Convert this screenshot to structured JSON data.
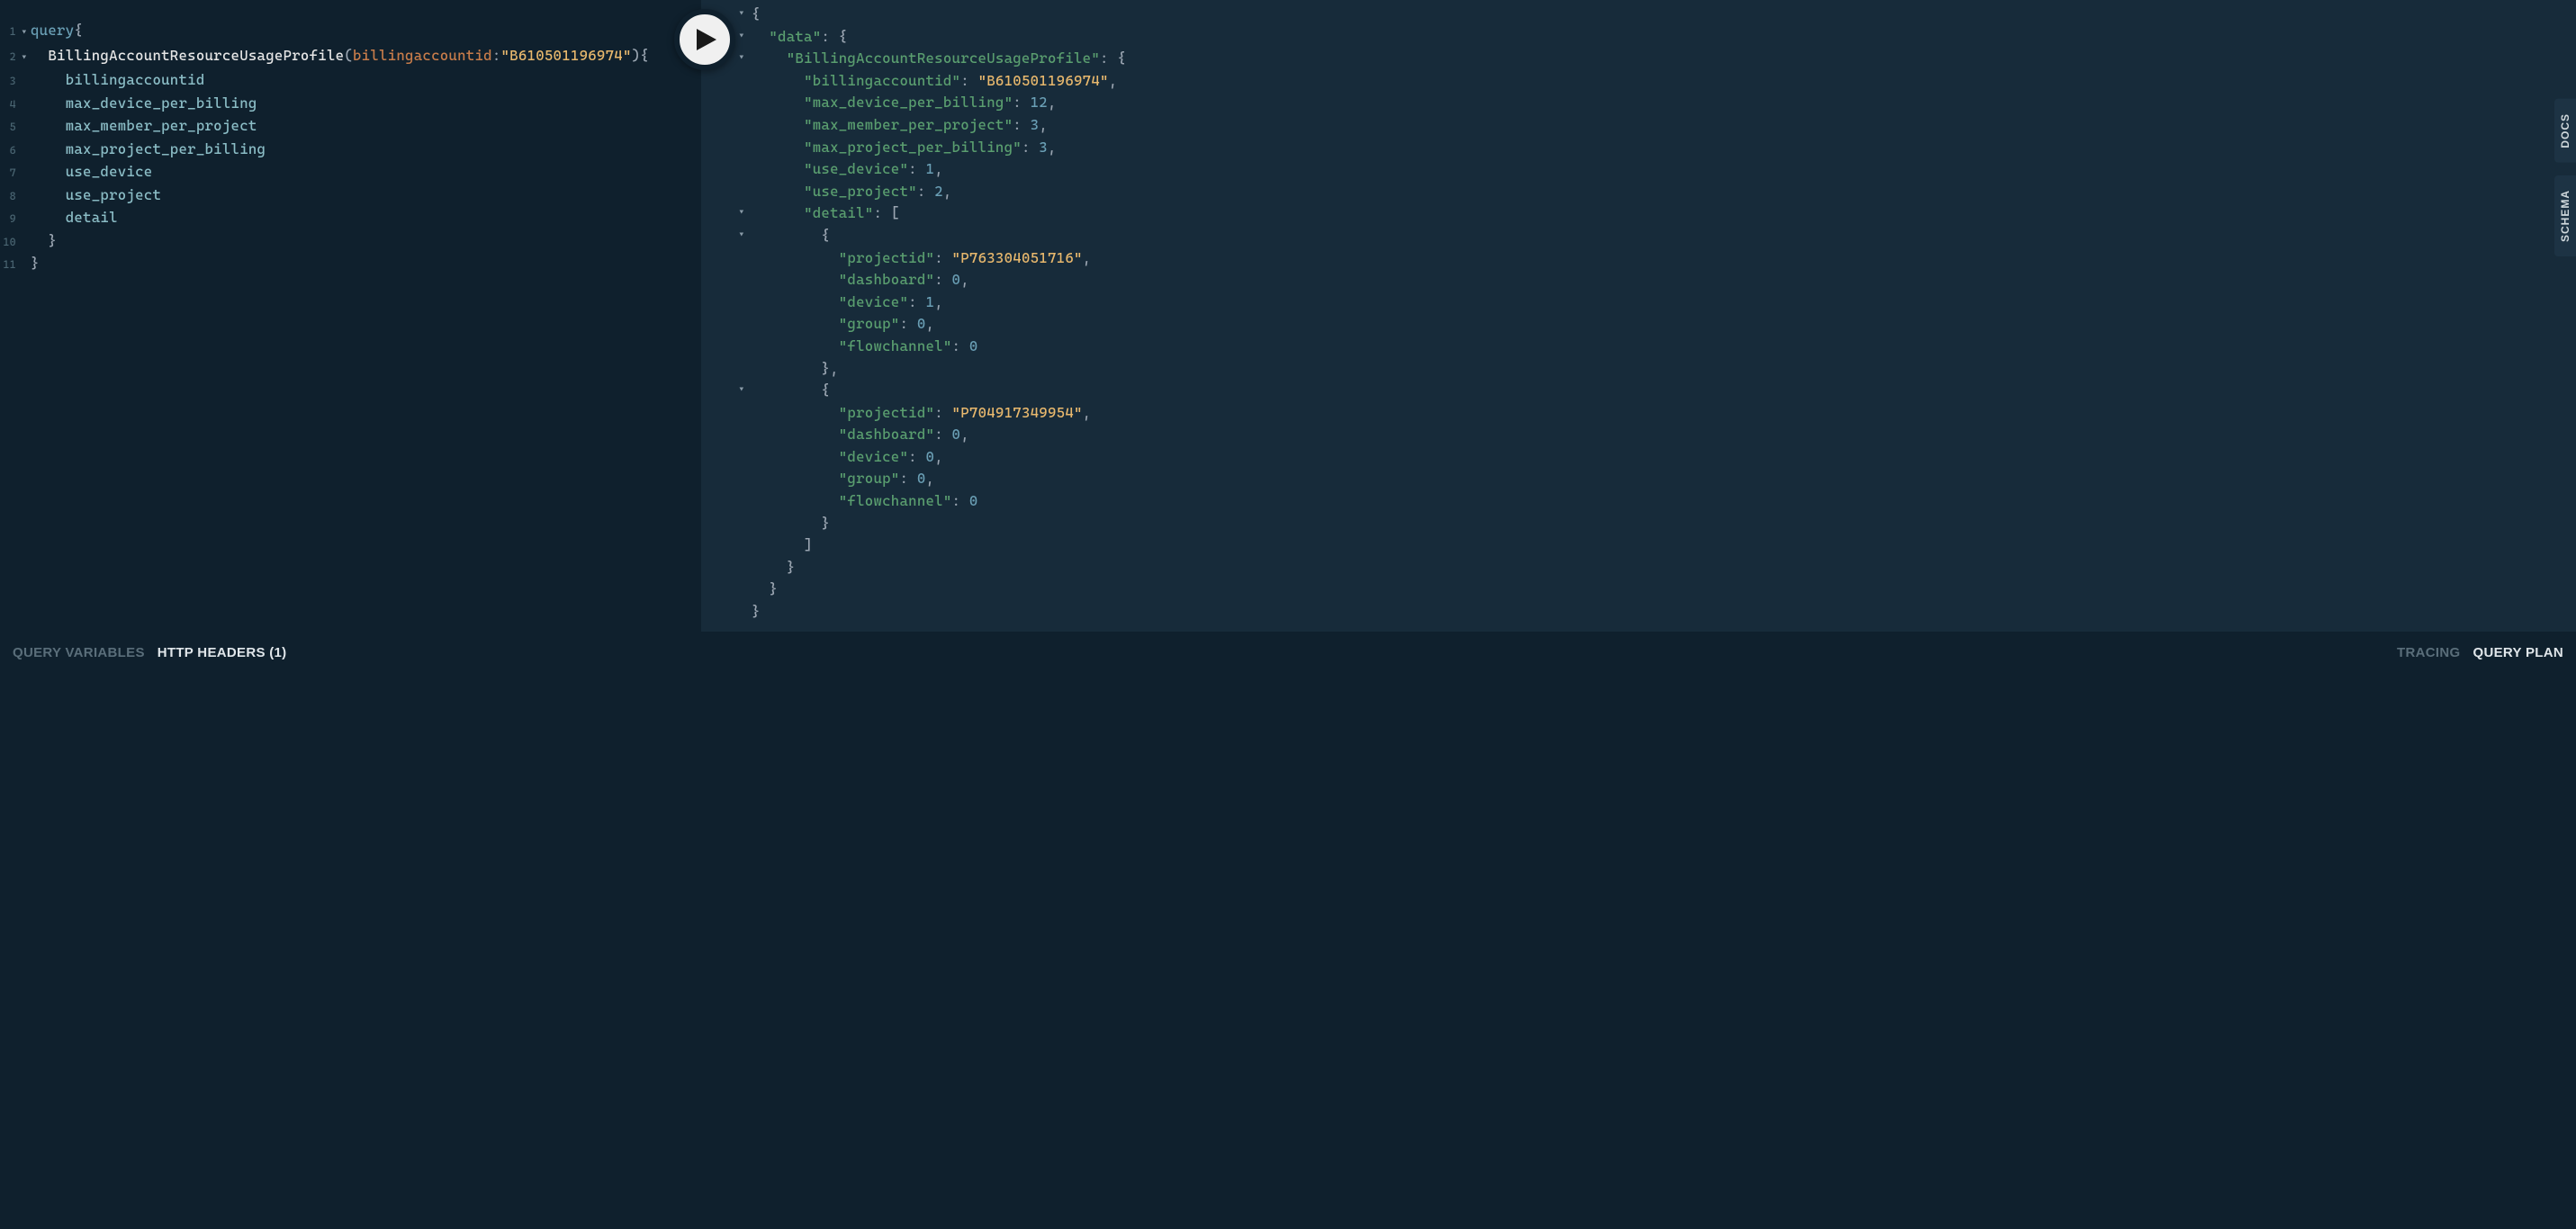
{
  "editor": {
    "lines": [
      {
        "n": 1,
        "fold": "▾",
        "tokens": [
          [
            "keyword",
            "query"
          ],
          [
            "punct",
            "{"
          ]
        ]
      },
      {
        "n": 2,
        "fold": "▾",
        "tokens": [
          [
            "plain",
            "  "
          ],
          [
            "def",
            "BillingAccountResourceUsageProfile"
          ],
          [
            "punct",
            "("
          ],
          [
            "attr",
            "billingaccountid"
          ],
          [
            "punct",
            ":"
          ],
          [
            "string",
            "\"B610501196974\""
          ],
          [
            "punct",
            "){"
          ]
        ]
      },
      {
        "n": 3,
        "fold": "",
        "tokens": [
          [
            "plain",
            "    "
          ],
          [
            "property",
            "billingaccountid"
          ]
        ]
      },
      {
        "n": 4,
        "fold": "",
        "tokens": [
          [
            "plain",
            "    "
          ],
          [
            "property",
            "max_device_per_billing"
          ]
        ]
      },
      {
        "n": 5,
        "fold": "",
        "tokens": [
          [
            "plain",
            "    "
          ],
          [
            "property",
            "max_member_per_project"
          ]
        ]
      },
      {
        "n": 6,
        "fold": "",
        "tokens": [
          [
            "plain",
            "    "
          ],
          [
            "property",
            "max_project_per_billing"
          ]
        ]
      },
      {
        "n": 7,
        "fold": "",
        "tokens": [
          [
            "plain",
            "    "
          ],
          [
            "property",
            "use_device"
          ]
        ]
      },
      {
        "n": 8,
        "fold": "",
        "tokens": [
          [
            "plain",
            "    "
          ],
          [
            "property",
            "use_project"
          ]
        ]
      },
      {
        "n": 9,
        "fold": "",
        "tokens": [
          [
            "plain",
            "    "
          ],
          [
            "property",
            "detail"
          ]
        ]
      },
      {
        "n": 10,
        "fold": "",
        "tokens": [
          [
            "plain",
            "  "
          ],
          [
            "punct",
            "}"
          ]
        ]
      },
      {
        "n": 11,
        "fold": "",
        "tokens": [
          [
            "punct",
            "}"
          ]
        ]
      }
    ]
  },
  "result": {
    "lines": [
      {
        "fold": "▾",
        "indent": 0,
        "tokens": [
          [
            "punct",
            "{"
          ]
        ]
      },
      {
        "fold": "▾",
        "indent": 1,
        "tokens": [
          [
            "key",
            "\"data\""
          ],
          [
            "punct",
            ": {"
          ]
        ]
      },
      {
        "fold": "▾",
        "indent": 2,
        "tokens": [
          [
            "key",
            "\"BillingAccountResourceUsageProfile\""
          ],
          [
            "punct",
            ": {"
          ]
        ]
      },
      {
        "fold": "",
        "indent": 3,
        "tokens": [
          [
            "key",
            "\"billingaccountid\""
          ],
          [
            "punct",
            ": "
          ],
          [
            "string",
            "\"B610501196974\""
          ],
          [
            "punct",
            ","
          ]
        ]
      },
      {
        "fold": "",
        "indent": 3,
        "tokens": [
          [
            "key",
            "\"max_device_per_billing\""
          ],
          [
            "punct",
            ": "
          ],
          [
            "num",
            "12"
          ],
          [
            "punct",
            ","
          ]
        ]
      },
      {
        "fold": "",
        "indent": 3,
        "tokens": [
          [
            "key",
            "\"max_member_per_project\""
          ],
          [
            "punct",
            ": "
          ],
          [
            "num",
            "3"
          ],
          [
            "punct",
            ","
          ]
        ]
      },
      {
        "fold": "",
        "indent": 3,
        "tokens": [
          [
            "key",
            "\"max_project_per_billing\""
          ],
          [
            "punct",
            ": "
          ],
          [
            "num",
            "3"
          ],
          [
            "punct",
            ","
          ]
        ]
      },
      {
        "fold": "",
        "indent": 3,
        "tokens": [
          [
            "key",
            "\"use_device\""
          ],
          [
            "punct",
            ": "
          ],
          [
            "num",
            "1"
          ],
          [
            "punct",
            ","
          ]
        ]
      },
      {
        "fold": "",
        "indent": 3,
        "tokens": [
          [
            "key",
            "\"use_project\""
          ],
          [
            "punct",
            ": "
          ],
          [
            "num",
            "2"
          ],
          [
            "punct",
            ","
          ]
        ]
      },
      {
        "fold": "▾",
        "indent": 3,
        "tokens": [
          [
            "key",
            "\"detail\""
          ],
          [
            "punct",
            ": ["
          ]
        ]
      },
      {
        "fold": "▾",
        "indent": 4,
        "tokens": [
          [
            "punct",
            "{"
          ]
        ]
      },
      {
        "fold": "",
        "indent": 5,
        "tokens": [
          [
            "key",
            "\"projectid\""
          ],
          [
            "punct",
            ": "
          ],
          [
            "string",
            "\"P763304051716\""
          ],
          [
            "punct",
            ","
          ]
        ]
      },
      {
        "fold": "",
        "indent": 5,
        "tokens": [
          [
            "key",
            "\"dashboard\""
          ],
          [
            "punct",
            ": "
          ],
          [
            "num",
            "0"
          ],
          [
            "punct",
            ","
          ]
        ]
      },
      {
        "fold": "",
        "indent": 5,
        "tokens": [
          [
            "key",
            "\"device\""
          ],
          [
            "punct",
            ": "
          ],
          [
            "num",
            "1"
          ],
          [
            "punct",
            ","
          ]
        ]
      },
      {
        "fold": "",
        "indent": 5,
        "tokens": [
          [
            "key",
            "\"group\""
          ],
          [
            "punct",
            ": "
          ],
          [
            "num",
            "0"
          ],
          [
            "punct",
            ","
          ]
        ]
      },
      {
        "fold": "",
        "indent": 5,
        "tokens": [
          [
            "key",
            "\"flowchannel\""
          ],
          [
            "punct",
            ": "
          ],
          [
            "num",
            "0"
          ]
        ]
      },
      {
        "fold": "",
        "indent": 4,
        "tokens": [
          [
            "punct",
            "},"
          ]
        ]
      },
      {
        "fold": "▾",
        "indent": 4,
        "tokens": [
          [
            "punct",
            "{"
          ]
        ]
      },
      {
        "fold": "",
        "indent": 5,
        "tokens": [
          [
            "key",
            "\"projectid\""
          ],
          [
            "punct",
            ": "
          ],
          [
            "string",
            "\"P704917349954\""
          ],
          [
            "punct",
            ","
          ]
        ]
      },
      {
        "fold": "",
        "indent": 5,
        "tokens": [
          [
            "key",
            "\"dashboard\""
          ],
          [
            "punct",
            ": "
          ],
          [
            "num",
            "0"
          ],
          [
            "punct",
            ","
          ]
        ]
      },
      {
        "fold": "",
        "indent": 5,
        "tokens": [
          [
            "key",
            "\"device\""
          ],
          [
            "punct",
            ": "
          ],
          [
            "num",
            "0"
          ],
          [
            "punct",
            ","
          ]
        ]
      },
      {
        "fold": "",
        "indent": 5,
        "tokens": [
          [
            "key",
            "\"group\""
          ],
          [
            "punct",
            ": "
          ],
          [
            "num",
            "0"
          ],
          [
            "punct",
            ","
          ]
        ]
      },
      {
        "fold": "",
        "indent": 5,
        "tokens": [
          [
            "key",
            "\"flowchannel\""
          ],
          [
            "punct",
            ": "
          ],
          [
            "num",
            "0"
          ]
        ]
      },
      {
        "fold": "",
        "indent": 4,
        "tokens": [
          [
            "punct",
            "}"
          ]
        ]
      },
      {
        "fold": "",
        "indent": 3,
        "tokens": [
          [
            "punct",
            "]"
          ]
        ]
      },
      {
        "fold": "",
        "indent": 2,
        "tokens": [
          [
            "punct",
            "}"
          ]
        ]
      },
      {
        "fold": "",
        "indent": 1,
        "tokens": [
          [
            "punct",
            "}"
          ]
        ]
      },
      {
        "fold": "",
        "indent": 0,
        "tokens": [
          [
            "punct",
            "}"
          ]
        ]
      }
    ]
  },
  "side_tabs": {
    "docs": "DOCS",
    "schema": "SCHEMA"
  },
  "footer": {
    "query_variables": "QUERY VARIABLES",
    "http_headers": "HTTP HEADERS (1)",
    "tracing": "TRACING",
    "query_plan": "QUERY PLAN"
  }
}
